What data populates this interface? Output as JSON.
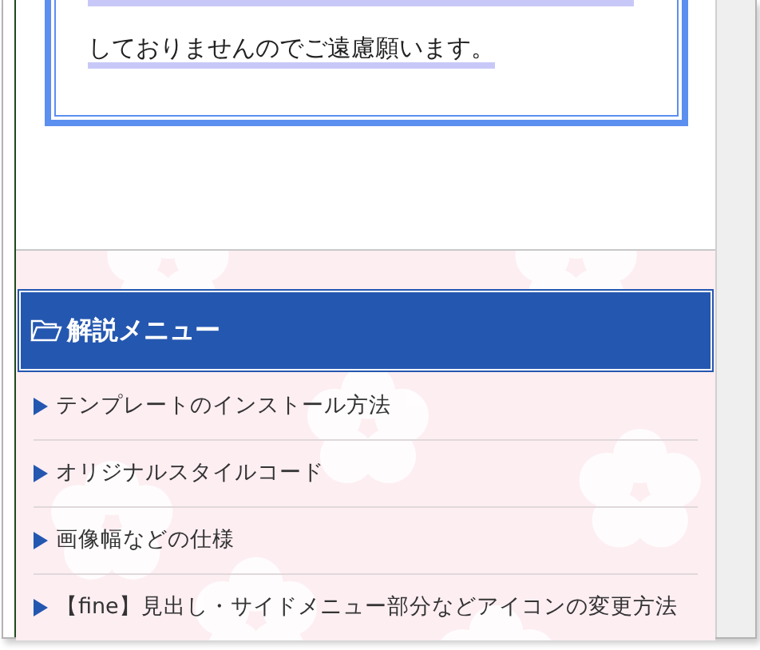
{
  "notice": {
    "text": "しておりませんのでご遠慮願います。"
  },
  "menu": {
    "title": "解説メニュー",
    "items": [
      {
        "label": "テンプレートのインストール方法"
      },
      {
        "label": "オリジナルスタイルコード"
      },
      {
        "label": "画像幅などの仕様"
      },
      {
        "label": "【fine】見出し・サイドメニュー部分などアイコンの変更方法"
      }
    ]
  }
}
